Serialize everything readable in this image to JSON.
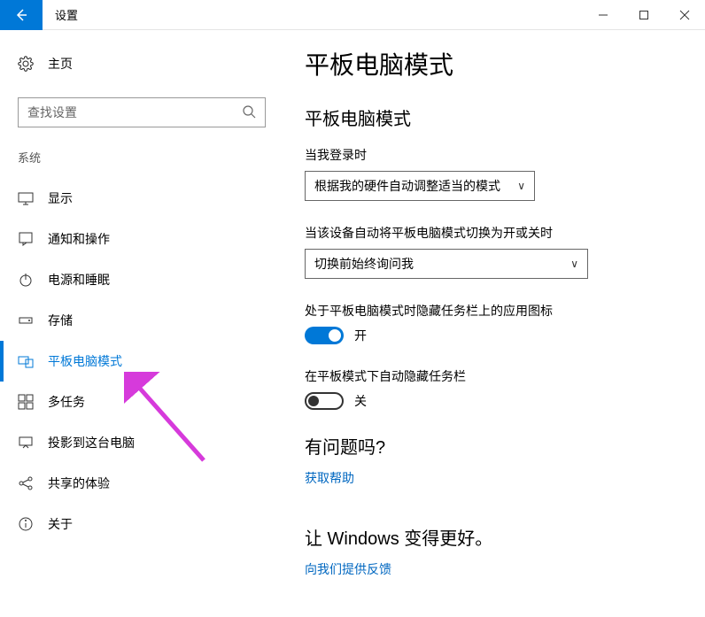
{
  "titlebar": {
    "title": "设置"
  },
  "sidebar": {
    "home": "主页",
    "search_placeholder": "查找设置",
    "category": "系统",
    "items": [
      {
        "label": "显示"
      },
      {
        "label": "通知和操作"
      },
      {
        "label": "电源和睡眠"
      },
      {
        "label": "存储"
      },
      {
        "label": "平板电脑模式"
      },
      {
        "label": "多任务"
      },
      {
        "label": "投影到这台电脑"
      },
      {
        "label": "共享的体验"
      },
      {
        "label": "关于"
      }
    ]
  },
  "main": {
    "page_title": "平板电脑模式",
    "section_title": "平板电脑模式",
    "signin_label": "当我登录时",
    "signin_value": "根据我的硬件自动调整适当的模式",
    "switch_label": "当该设备自动将平板电脑模式切换为开或关时",
    "switch_value": "切换前始终询问我",
    "hide_icons_label": "处于平板电脑模式时隐藏任务栏上的应用图标",
    "hide_icons_state": "开",
    "hide_taskbar_label": "在平板模式下自动隐藏任务栏",
    "hide_taskbar_state": "关",
    "help_title": "有问题吗?",
    "help_link": "获取帮助",
    "better_title": "让 Windows 变得更好。",
    "feedback_link": "向我们提供反馈"
  }
}
